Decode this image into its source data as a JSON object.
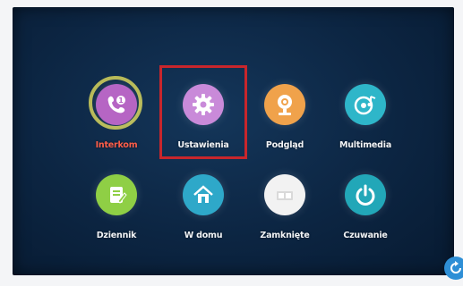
{
  "menu": {
    "items": [
      {
        "label": "Interkom",
        "icon": "phone-icon",
        "color": "#b665c4"
      },
      {
        "label": "Ustawienia",
        "icon": "gear-icon",
        "color": "#c98ad9"
      },
      {
        "label": "Podgląd",
        "icon": "camera-icon",
        "color": "#f0a24b"
      },
      {
        "label": "Multimedia",
        "icon": "music-disc-icon",
        "color": "#2eb6c9"
      },
      {
        "label": "Dziennik",
        "icon": "notebook-icon",
        "color": "#8fcf45"
      },
      {
        "label": "W domu",
        "icon": "home-icon",
        "color": "#2ea8c9"
      },
      {
        "label": "Zamknięte",
        "icon": "lock-icon",
        "color": "#f2f2f2"
      },
      {
        "label": "Czuwanie",
        "icon": "power-icon",
        "color": "#22a7b8"
      }
    ],
    "active_item": "Interkom",
    "selected_item": "Ustawienia",
    "intercom_badge": "1"
  },
  "colors": {
    "active_label": "#ff5e4a",
    "selection_frame": "#c8262c",
    "ring": "#d6d35a"
  }
}
